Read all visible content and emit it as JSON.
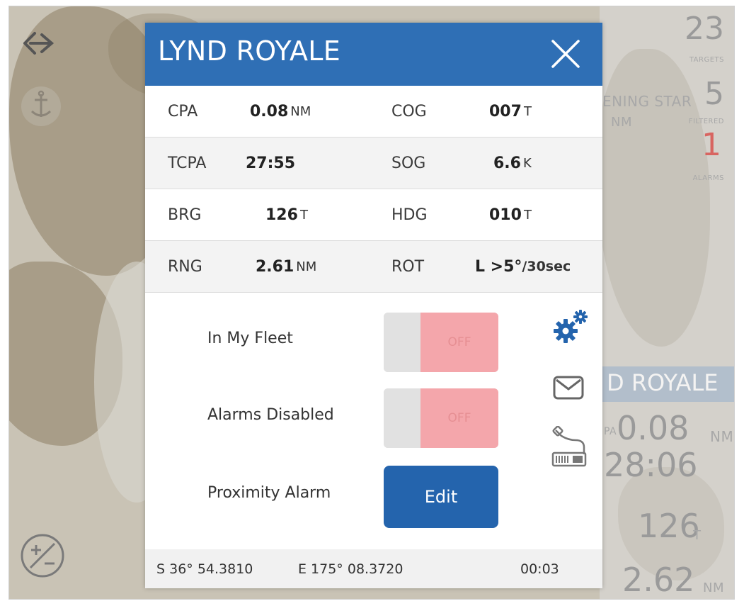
{
  "background": {
    "targets_count": "23",
    "targets_label": "TARGETS",
    "filtered_count": "5",
    "filtered_label": "FILTERED",
    "alarms_count": "1",
    "alarms_label": "ALARMS",
    "ghost_name": "ENING STAR",
    "ghost_unit": "NM",
    "ghost_vessel": "D ROYALE",
    "ghost_cpa": "0.08",
    "ghost_cpa_unit": "NM",
    "ghost_tcpa": "28:06",
    "ghost_brg": "126",
    "ghost_brg_unit": "T",
    "ghost_rng": "2.62",
    "ghost_rng_unit": "NM",
    "ghost_pa": "PA"
  },
  "popup": {
    "title": "LYND ROYALE",
    "rows": [
      {
        "l1": "CPA",
        "v1": "0.08",
        "u1": "NM",
        "l2": "COG",
        "v2": "007",
        "u2": "T"
      },
      {
        "l1": "TCPA",
        "v1": "27:55",
        "u1": "",
        "l2": "SOG",
        "v2": "6.6",
        "u2": "K"
      },
      {
        "l1": "BRG",
        "v1": "126",
        "u1": "T",
        "l2": "HDG",
        "v2": "010",
        "u2": "T"
      },
      {
        "l1": "RNG",
        "v1": "2.61",
        "u1": "NM",
        "l2": "ROT",
        "v2": "L >5°",
        "u2": "/30sec"
      }
    ],
    "controls": {
      "fleet_label": "In My Fleet",
      "fleet_state": "OFF",
      "alarms_label": "Alarms Disabled",
      "alarms_state": "OFF",
      "proximity_label": "Proximity Alarm",
      "edit_label": "Edit"
    },
    "footer": {
      "lat": "S 36° 54.3810",
      "lon": "E 175° 08.3720",
      "time": "00:03"
    }
  },
  "colors": {
    "header": "#2f6fb5",
    "edit_button": "#2464ad",
    "toggle_off": "#f4a6ab",
    "alarm_red": "#d9534f"
  },
  "icons": [
    "back-arrow-icon",
    "anchor-icon",
    "zoom-icon",
    "close-icon",
    "settings-gears-icon",
    "envelope-icon",
    "vhf-radio-icon"
  ]
}
